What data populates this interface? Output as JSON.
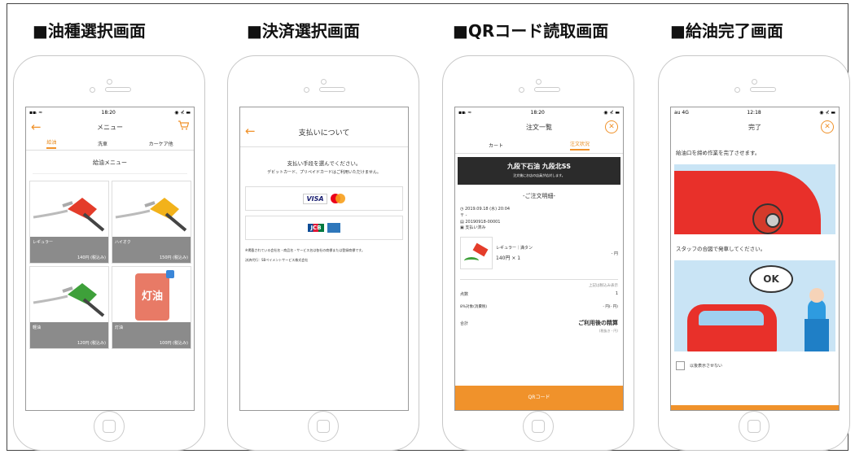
{
  "headings": [
    "■油種選択画面",
    "■決済選択画面",
    "■QRコード読取画面",
    "■給油完了画面"
  ],
  "status": {
    "time1": "18:20",
    "time2": "18:20",
    "time4": "12:18",
    "carrier4": "au 4G"
  },
  "screen1": {
    "title": "メニュー",
    "tabs": [
      "給油",
      "洗車",
      "カーケア他"
    ],
    "section": "給油メニュー",
    "items": [
      {
        "name": "レギュラー",
        "price": "140円 (税込み)",
        "color": "#e43c2a"
      },
      {
        "name": "ハイオク",
        "price": "150円 (税込み)",
        "color": "#f2b21b"
      },
      {
        "name": "軽油",
        "price": "120円 (税込み)",
        "color": "#3ea03a"
      },
      {
        "name": "灯油",
        "price": "100円 (税込み)",
        "color": "#e87a66",
        "can_label": "灯油"
      }
    ]
  },
  "screen2": {
    "title": "支払いについて",
    "intro1": "支払い手段を選んでください。",
    "intro2": "デビットカード、プリペイドカードはご利用いただけません。",
    "visa": "VISA",
    "jcb": "JCB",
    "note1": "※掲載されている会社名・商品名・サービス名は各社の商標または登録商標です。",
    "note2": "決済代行：SBペイメントサービス株式会社"
  },
  "screen3": {
    "title": "注文一覧",
    "tabs": [
      "カート",
      "注文状況"
    ],
    "shop": "九段下石油 九段北SS",
    "shop_sub": "注文後にお店の店員が応対します。",
    "details_title": "-ご注文明細-",
    "date": "2019.09.18 (水) 20:04",
    "hash": "〒 -",
    "order_no": "20190918-00001",
    "pay_status": "支払い済み",
    "item_name": "レギュラー｜満タン",
    "item_qty": "140円 × 1",
    "item_price": "- 円",
    "tax_note": "上記は税込み表示",
    "count_label": "点数",
    "count_value": "1",
    "tax_label": "8%対象(消費税)",
    "tax_value": "- 円(- 円)",
    "total_label": "合計",
    "total_value": "ご利用後の精算",
    "total_sub": "(税抜き - 円)",
    "qr_button": "QRコード"
  },
  "screen4": {
    "title": "完了",
    "msg1": "給油口を締め作業を完了させます。",
    "msg2": "スタッフの合図で発車してください。",
    "bubble": "OK",
    "checkbox_label": "以後表示させない"
  }
}
